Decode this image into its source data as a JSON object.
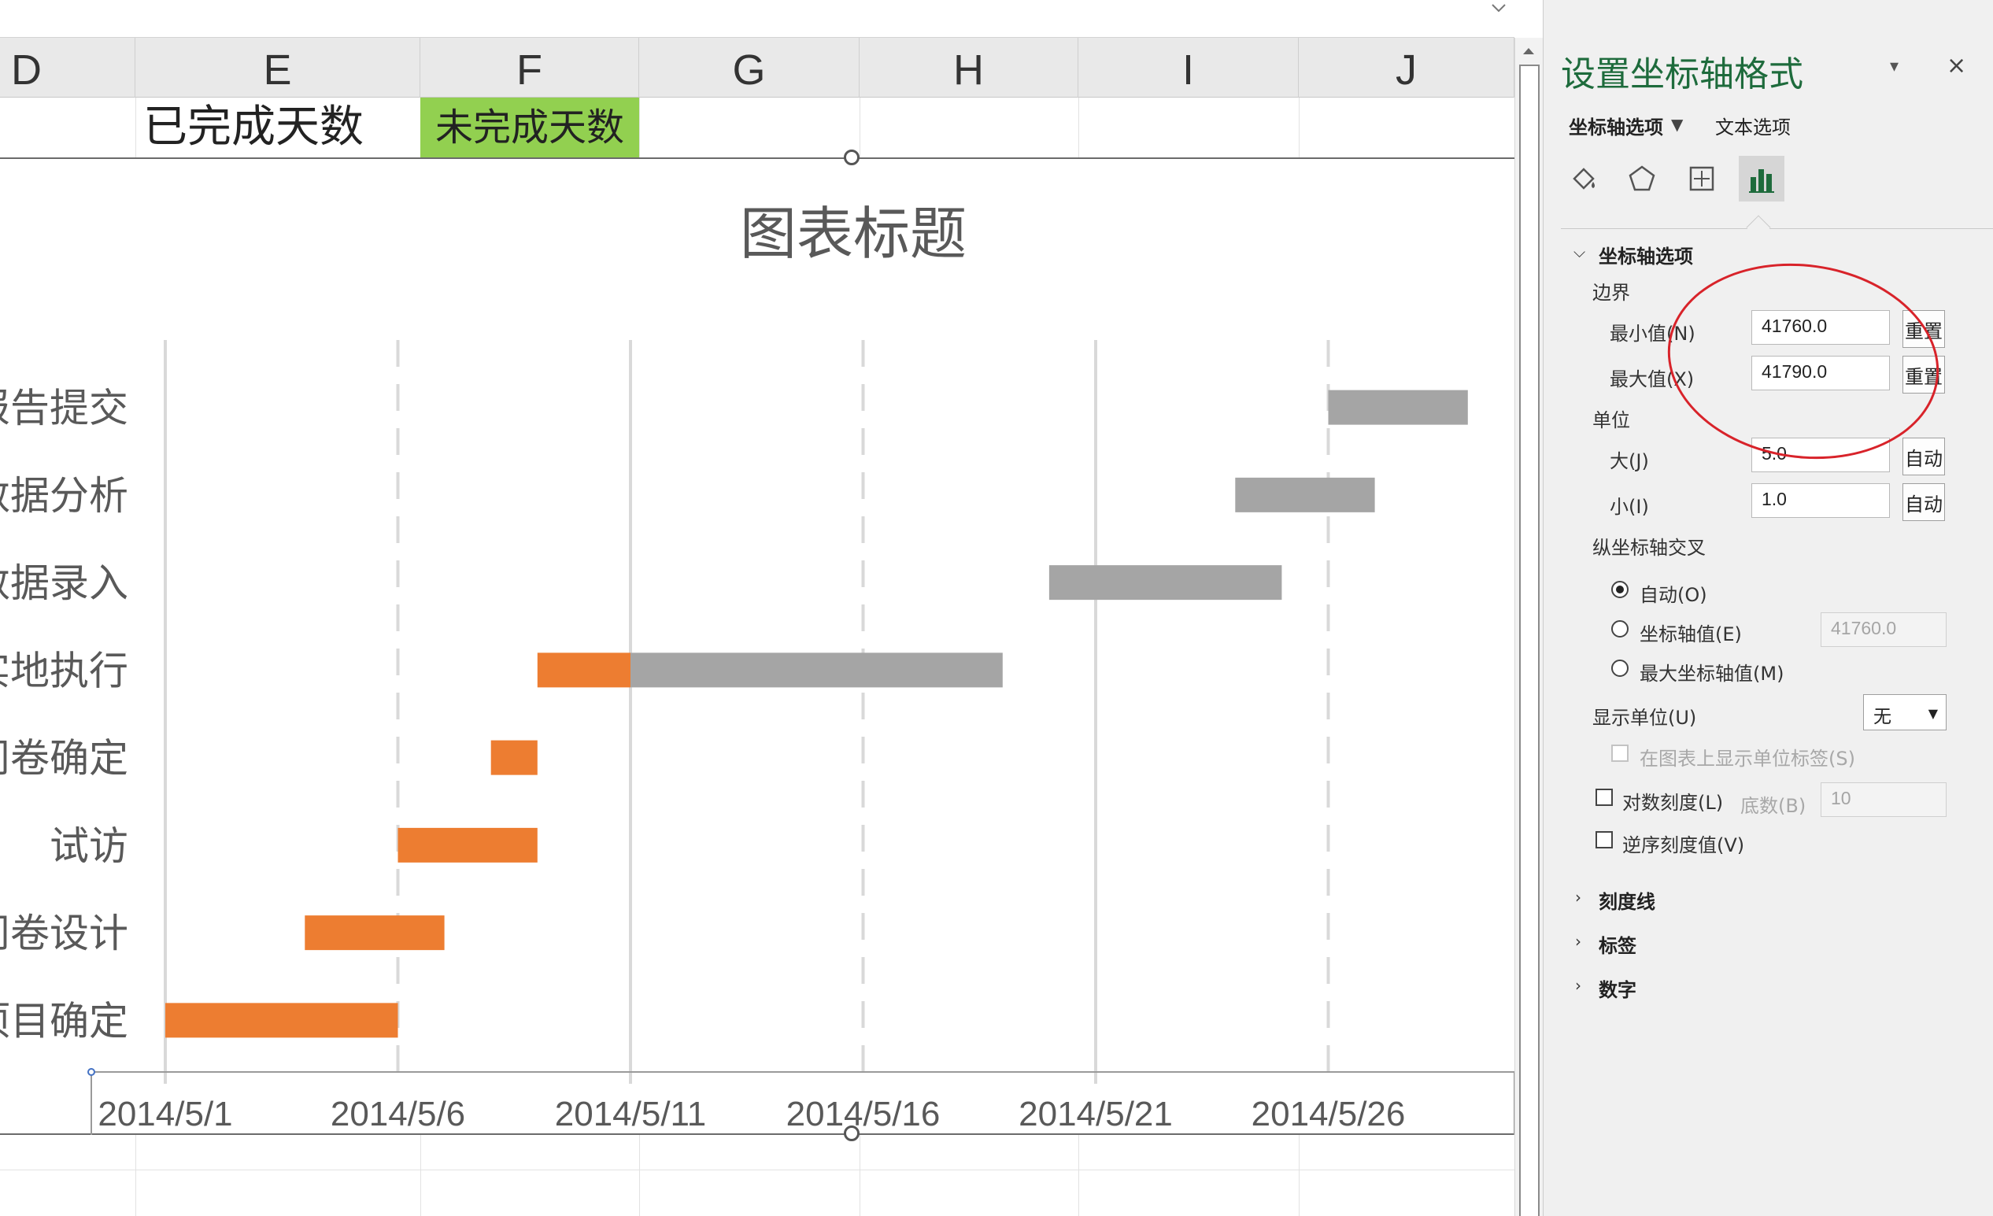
{
  "sheet": {
    "columns": [
      "D",
      "E",
      "F",
      "G",
      "H",
      "I",
      "J"
    ],
    "row2": {
      "e": "已完成天数",
      "f": "未完成天数"
    }
  },
  "colors": {
    "done": "#ed7d31",
    "remaining": "#a5a5a5",
    "header_green": "#92d050",
    "title_green": "#1e6b3c",
    "annotation_red": "#d8232a"
  },
  "chart_data": {
    "type": "bar",
    "orientation": "horizontal",
    "stacked": true,
    "title": "图表标题",
    "categories": [
      "项目确定",
      "问卷设计",
      "试访",
      "问卷确定",
      "实地执行",
      "数据录入",
      "数据分析",
      "报告提交"
    ],
    "category_labels_visible": [
      "项目确定",
      "问卷设计",
      "试访",
      "问卷确定",
      "实地执行",
      "数据录入",
      "数据分析",
      "报告提交"
    ],
    "x_tick_labels": [
      "2014/5/1",
      "2014/5/6",
      "2014/5/11",
      "2014/5/16",
      "2014/5/21",
      "2014/5/26"
    ],
    "xlim": [
      41760,
      41790
    ],
    "x_major_unit": 5,
    "gridlines": true,
    "series": [
      {
        "name": "已完成天数",
        "start": [
          41760,
          41763,
          41765,
          41767,
          41768,
          41779,
          41783,
          41785
        ],
        "values": [
          5,
          3,
          3,
          1,
          2,
          0,
          0,
          0
        ]
      },
      {
        "name": "未完成天数",
        "start": [
          41765,
          41766,
          41768,
          41768,
          41770,
          41779,
          41783,
          41785
        ],
        "values": [
          0,
          0,
          0,
          0,
          8,
          5,
          3,
          3
        ]
      }
    ]
  },
  "pane": {
    "title": "设置坐标轴格式",
    "tabs": {
      "axis_options": "坐标轴选项",
      "text_options": "文本选项"
    },
    "section_axis": "坐标轴选项",
    "bounds_label": "边界",
    "min_label": "最小值(N)",
    "min_value": "41760.0",
    "max_label": "最大值(X)",
    "max_value": "41790.0",
    "reset_label": "重置",
    "units_label": "单位",
    "major_label": "大(J)",
    "major_value": "5.0",
    "minor_label": "小(I)",
    "minor_value": "1.0",
    "auto_label": "自动",
    "cross_label": "纵坐标轴交叉",
    "radio_auto": "自动(O)",
    "radio_value": "坐标轴值(E)",
    "radio_value_input": "41760.0",
    "radio_max": "最大坐标轴值(M)",
    "display_units_label": "显示单位(U)",
    "display_units_value": "无",
    "show_units_label": "在图表上显示单位标签(S)",
    "log_label": "对数刻度(L)",
    "base_label": "底数(B)",
    "base_value": "10",
    "reverse_label": "逆序刻度值(V)",
    "section_ticks": "刻度线",
    "section_labels": "标签",
    "section_number": "数字"
  }
}
